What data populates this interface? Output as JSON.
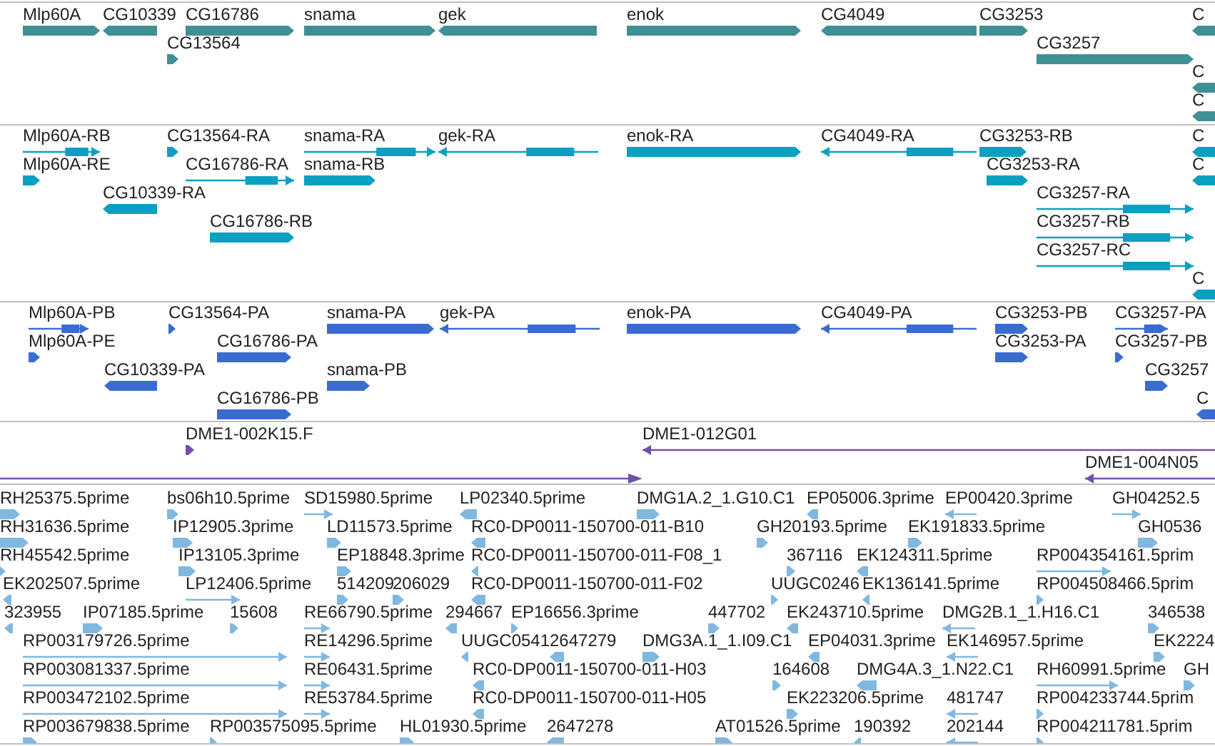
{
  "tracks": [
    {
      "kind": "gene",
      "features": [
        {
          "label": "Mlp60A",
          "reverse": false
        },
        {
          "label": "CG10339",
          "reverse": true
        },
        {
          "label": "CG16786",
          "reverse": false
        },
        {
          "label": "snama",
          "reverse": false
        },
        {
          "label": "gek",
          "reverse": true
        },
        {
          "label": "enok",
          "reverse": false
        },
        {
          "label": "CG4049",
          "reverse": true
        },
        {
          "label": "CG3253",
          "reverse": false
        },
        {
          "label": "C",
          "reverse": true
        },
        {
          "label": "CG13564",
          "reverse": false
        },
        {
          "label": "CG3257",
          "reverse": false
        },
        {
          "label": "C",
          "reverse": true
        },
        {
          "label": "C",
          "reverse": true
        }
      ]
    },
    {
      "kind": "transcript",
      "features": [
        {
          "label": "Mlp60A-RB",
          "reverse": false
        },
        {
          "label": "CG13564-RA",
          "reverse": false
        },
        {
          "label": "snama-RA",
          "reverse": false
        },
        {
          "label": "gek-RA",
          "reverse": true
        },
        {
          "label": "enok-RA",
          "reverse": false
        },
        {
          "label": "CG4049-RA",
          "reverse": true
        },
        {
          "label": "CG3253-RB",
          "reverse": false
        },
        {
          "label": "C",
          "reverse": true
        },
        {
          "label": "Mlp60A-RE",
          "reverse": false
        },
        {
          "label": "CG16786-RA",
          "reverse": false
        },
        {
          "label": "snama-RB",
          "reverse": false
        },
        {
          "label": "CG3253-RA",
          "reverse": false
        },
        {
          "label": "C",
          "reverse": true
        },
        {
          "label": "CG10339-RA",
          "reverse": true
        },
        {
          "label": "CG3257-RA",
          "reverse": false
        },
        {
          "label": "CG16786-RB",
          "reverse": false
        },
        {
          "label": "CG3257-RB",
          "reverse": false
        },
        {
          "label": "CG3257-RC",
          "reverse": false
        },
        {
          "label": "C",
          "reverse": true
        }
      ]
    },
    {
      "kind": "protein",
      "features": [
        {
          "label": "Mlp60A-PB",
          "reverse": false
        },
        {
          "label": "CG13564-PA",
          "reverse": false
        },
        {
          "label": "snama-PA",
          "reverse": false
        },
        {
          "label": "gek-PA",
          "reverse": true
        },
        {
          "label": "enok-PA",
          "reverse": false
        },
        {
          "label": "CG4049-PA",
          "reverse": true
        },
        {
          "label": "CG3253-PB",
          "reverse": false
        },
        {
          "label": "CG3257-PA",
          "reverse": false
        },
        {
          "label": "Mlp60A-PE",
          "reverse": false
        },
        {
          "label": "CG16786-PA",
          "reverse": false
        },
        {
          "label": "CG3253-PA",
          "reverse": false
        },
        {
          "label": "CG3257-PB",
          "reverse": false
        },
        {
          "label": "CG10339-PA",
          "reverse": true
        },
        {
          "label": "snama-PB",
          "reverse": false
        },
        {
          "label": "CG3257",
          "reverse": false
        },
        {
          "label": "CG16786-PB",
          "reverse": false
        },
        {
          "label": "C",
          "reverse": true
        }
      ]
    },
    {
      "kind": "clone",
      "features": [
        {
          "label": "DME1-002K15.F",
          "reverse": false
        },
        {
          "label": "DME1-012G01",
          "reverse": true
        },
        {
          "label": "DME1-004N05",
          "reverse": true
        }
      ]
    },
    {
      "kind": "est",
      "features": [
        {
          "label": "RH25375.5prime",
          "reverse": false
        },
        {
          "label": "bs06h10.5prime",
          "reverse": false
        },
        {
          "label": "SD15980.5prime",
          "reverse": false
        },
        {
          "label": "LP02340.5prime",
          "reverse": true
        },
        {
          "label": "DMG1A.2_1.G10.C1",
          "reverse": false
        },
        {
          "label": "EP05006.3prime",
          "reverse": true
        },
        {
          "label": "EP00420.3prime",
          "reverse": true
        },
        {
          "label": "GH04252.5",
          "reverse": false
        },
        {
          "label": "RH31636.5prime",
          "reverse": false
        },
        {
          "label": "IP12905.3prime",
          "reverse": false
        },
        {
          "label": "LD11573.5prime",
          "reverse": false
        },
        {
          "label": "RC0-DP0011-150700-011-B10",
          "reverse": true
        },
        {
          "label": "GH20193.5prime",
          "reverse": false
        },
        {
          "label": "EK191833.5prime",
          "reverse": false
        },
        {
          "label": "GH0536",
          "reverse": false
        },
        {
          "label": "RH45542.5prime",
          "reverse": false
        },
        {
          "label": "IP13105.3prime",
          "reverse": false
        },
        {
          "label": "EP18848.3prime",
          "reverse": false
        },
        {
          "label": "RC0-DP0011-150700-011-F08_1",
          "reverse": true
        },
        {
          "label": "367116",
          "reverse": false
        },
        {
          "label": "EK124311.5prime",
          "reverse": true
        },
        {
          "label": "RP004354161.5prim",
          "reverse": false
        },
        {
          "label": "EK202507.5prime",
          "reverse": true
        },
        {
          "label": "LP12406.5prime",
          "reverse": false
        },
        {
          "label": "514209",
          "reverse": false
        },
        {
          "label": "206029",
          "reverse": false
        },
        {
          "label": "RC0-DP0011-150700-011-F02",
          "reverse": true
        },
        {
          "label": "UUGC0246",
          "reverse": false
        },
        {
          "label": "EK136141.5prime",
          "reverse": true
        },
        {
          "label": "RP004508466.5prim",
          "reverse": false
        },
        {
          "label": "323955",
          "reverse": true
        },
        {
          "label": "IP07185.5prime",
          "reverse": false
        },
        {
          "label": "15608",
          "reverse": false
        },
        {
          "label": "RE66790.5prime",
          "reverse": false
        },
        {
          "label": "294667",
          "reverse": true
        },
        {
          "label": "EP16656.3prime",
          "reverse": false
        },
        {
          "label": "447702",
          "reverse": false
        },
        {
          "label": "EK243710.5prime",
          "reverse": true
        },
        {
          "label": "DMG2B.1_1.H16.C1",
          "reverse": true
        },
        {
          "label": "346538",
          "reverse": false
        },
        {
          "label": "RP003179726.5prime",
          "reverse": false
        },
        {
          "label": "RE14296.5prime",
          "reverse": false
        },
        {
          "label": "UUGC0541",
          "reverse": true
        },
        {
          "label": "2647279",
          "reverse": true
        },
        {
          "label": "DMG3A.1_1.I09.C1",
          "reverse": false
        },
        {
          "label": "EP04031.3prime",
          "reverse": true
        },
        {
          "label": "EK146957.5prime",
          "reverse": true
        },
        {
          "label": "EK2224",
          "reverse": false
        },
        {
          "label": "RP003081337.5prime",
          "reverse": false
        },
        {
          "label": "RE06431.5prime",
          "reverse": false
        },
        {
          "label": "RC0-DP0011-150700-011-H03",
          "reverse": true
        },
        {
          "label": "164608",
          "reverse": false
        },
        {
          "label": "DMG4A.3_1.N22.C1",
          "reverse": true
        },
        {
          "label": "RH60991.5prime",
          "reverse": false
        },
        {
          "label": "GH",
          "reverse": false
        },
        {
          "label": "RP003472102.5prime",
          "reverse": false
        },
        {
          "label": "RE53784.5prime",
          "reverse": false
        },
        {
          "label": "RC0-DP0011-150700-011-H05",
          "reverse": true
        },
        {
          "label": "EK223206.5prime",
          "reverse": false
        },
        {
          "label": "481747",
          "reverse": true
        },
        {
          "label": "RP004233744.5prim",
          "reverse": false
        },
        {
          "label": "RP003679838.5prime",
          "reverse": false
        },
        {
          "label": "RP003575095.5prime",
          "reverse": false
        },
        {
          "label": "HL01930.5prime",
          "reverse": false
        },
        {
          "label": "2647278",
          "reverse": true
        },
        {
          "label": "AT01526.5prime",
          "reverse": false
        },
        {
          "label": "190392",
          "reverse": true
        },
        {
          "label": "202144",
          "reverse": true
        },
        {
          "label": "RP004211781.5prim",
          "reverse": false
        }
      ]
    }
  ]
}
